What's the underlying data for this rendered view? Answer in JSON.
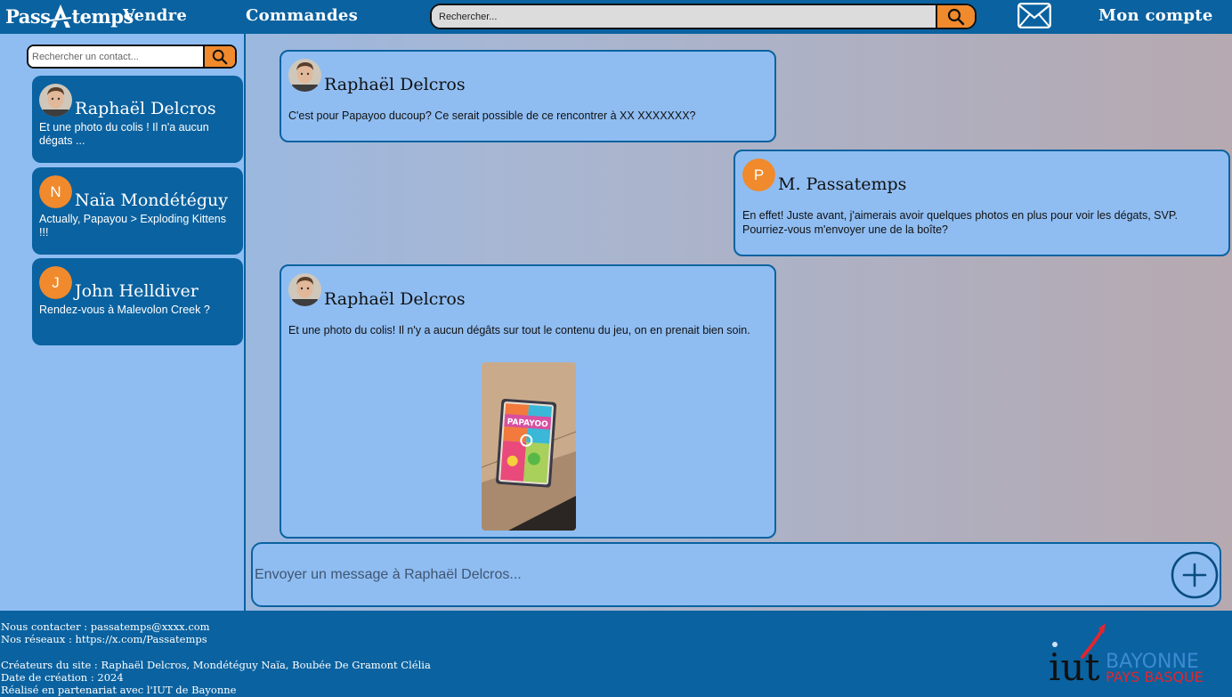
{
  "header": {
    "logo_text_before": "Pass",
    "logo_text_after": "temps",
    "nav_vendre": "Vendre",
    "nav_commandes": "Commandes",
    "search_placeholder": "Rechercher...",
    "nav_compte": "Mon compte",
    "icons": {
      "search": "search-icon",
      "mail": "mail-icon"
    }
  },
  "sidebar": {
    "search_placeholder": "Rechercher un contact...",
    "contacts": [
      {
        "name": "Raphaël Delcros",
        "preview": "Et une photo du colis ! Il n'a aucun dégats ...",
        "avatar": "photo"
      },
      {
        "name": "Naïa Mondétéguy",
        "preview": "Actually, Papayou > Exploding Kittens !!!",
        "avatar_letter": "N"
      },
      {
        "name": "John Helldiver",
        "preview": "Rendez-vous à Malevolon Creek ?",
        "avatar_letter": "J"
      }
    ]
  },
  "conversation": {
    "messages": [
      {
        "author": "Raphaël Delcros",
        "text": "C'est pour Papayoo ducoup? Ce serait possible de ce rencontrer à XX XXXXXXX?",
        "avatar": "photo"
      },
      {
        "author": "M. Passatemps",
        "avatar_letter": "P",
        "line1": "En effet! Juste avant, j'aimerais avoir quelques photos en plus pour voir les dégats, SVP.",
        "line2": "Pourriez-vous m'envoyer une de la boîte?"
      },
      {
        "author": "Raphaël Delcros",
        "text": "Et une photo du colis! Il n'y a aucun dégâts sur tout le contenu du jeu, on en prenait bien soin.",
        "avatar": "photo",
        "attachment": "photo of Papayoo game box"
      }
    ],
    "composer_placeholder": "Envoyer un message à Raphaël Delcros..."
  },
  "footer": {
    "contact": "Nous contacter : passatemps@xxxx.com",
    "networks": "Nos réseaux : https://x.com/Passatemps",
    "creators": "Créateurs du site : Raphaël Delcros, Mondétéguy Naïa, Boubée De Gramont Clélia",
    "date": "Date de création : 2024",
    "partner": "Réalisé en partenariat avec l'IUT de Bayonne",
    "iut_logo_main": "iut",
    "iut_logo_city": "BAYONNE",
    "iut_logo_region": "PAYS BASQUE"
  },
  "colors": {
    "brand_blue": "#0a62a0",
    "light_blue": "#8fbdf2",
    "accent_orange": "#f08a2c",
    "iut_red": "#e0262f"
  }
}
